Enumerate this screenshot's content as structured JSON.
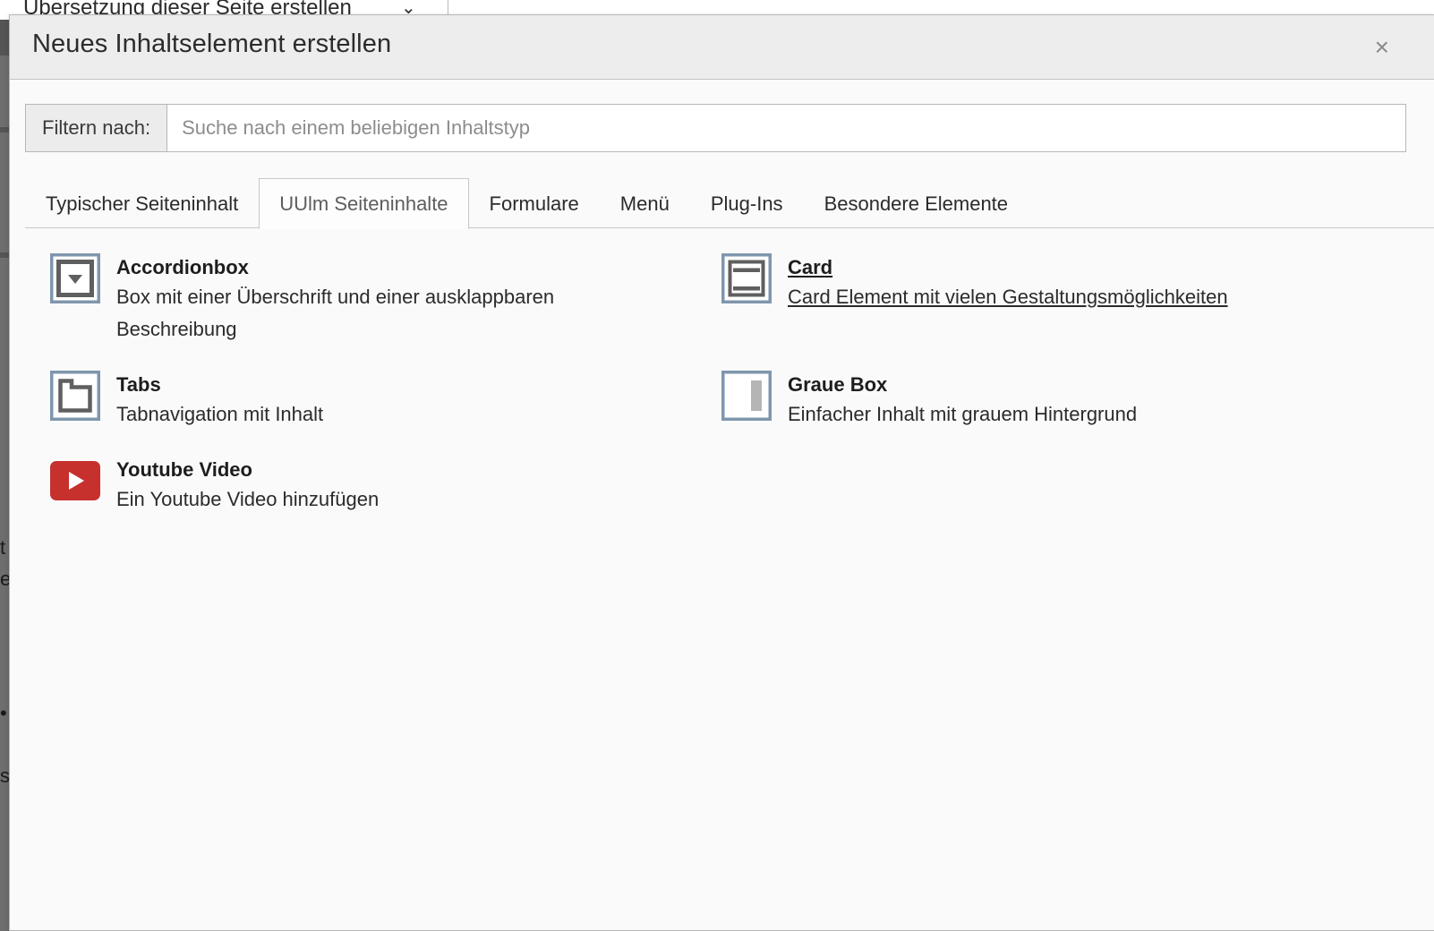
{
  "background": {
    "top_text": "Übersetzung dieser Seite erstellen",
    "top_chevron": "chevron-down-icon"
  },
  "modal": {
    "title": "Neues Inhaltselement erstellen",
    "close_label": "×",
    "filter": {
      "prefix_label": "Filtern nach:",
      "placeholder": "Suche nach einem beliebigen Inhaltstyp",
      "value": ""
    },
    "tabs": [
      {
        "label": "Typischer Seiteninhalt",
        "active": false
      },
      {
        "label": "UUlm Seiteninhalte",
        "active": true
      },
      {
        "label": "Formulare",
        "active": false
      },
      {
        "label": "Menü",
        "active": false
      },
      {
        "label": "Plug-Ins",
        "active": false
      },
      {
        "label": "Besondere Elemente",
        "active": false
      }
    ],
    "items": [
      {
        "icon": "accordion-icon",
        "name": "Accordionbox",
        "description": "Box mit einer Überschrift und einer ausklappbaren Beschreibung",
        "hovered": false
      },
      {
        "icon": "card-icon",
        "name": "Card",
        "description": "Card Element mit vielen Gestaltungsmöglichkeiten",
        "hovered": true
      },
      {
        "icon": "tabs-icon",
        "name": "Tabs",
        "description": "Tabnavigation mit Inhalt",
        "hovered": false
      },
      {
        "icon": "grey-box-icon",
        "name": "Graue Box",
        "description": "Einfacher Inhalt mit grauem Hintergrund",
        "hovered": false
      },
      {
        "icon": "youtube-icon",
        "name": "Youtube Video",
        "description": "Ein Youtube Video hinzufügen",
        "hovered": false
      }
    ]
  },
  "colors": {
    "icon_border": "#7f96ad",
    "icon_stroke": "#5f5f5f",
    "icon_grey_fill": "#b5b5b5",
    "youtube_red": "#c6302d",
    "header_bg": "#ededed",
    "body_bg": "#fafafa",
    "border": "#b6b6b6"
  }
}
